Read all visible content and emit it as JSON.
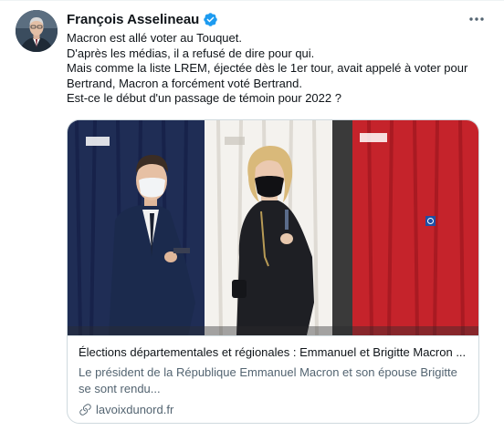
{
  "author": {
    "name": "François Asselineau",
    "verified": true
  },
  "tweet": {
    "lines": [
      "Macron est allé voter au Touquet.",
      "D'après les médias, il a refusé de dire pour qui.",
      "Mais comme la liste LREM, éjectée dès le 1er tour, avait appelé à voter pour",
      "Bertrand, Macron a forcément voté Bertrand.",
      "Est-ce le début d'un passage de témoin pour 2022 ?"
    ]
  },
  "card": {
    "title": "Élections départementales et régionales : Emmanuel et Brigitte Macron ...",
    "description_lines": [
      "Le président de la République Emmanuel Macron et son épouse Brigitte",
      "se sont rendu..."
    ],
    "domain": "lavoixdunord.fr"
  },
  "icons": {
    "verified": "verified-badge-icon",
    "more": "more-options-icon",
    "link": "link-icon"
  },
  "colors": {
    "accent": "#1d9bf0",
    "text": "#0f1419",
    "secondary": "#536471",
    "border": "#cfd9de"
  }
}
